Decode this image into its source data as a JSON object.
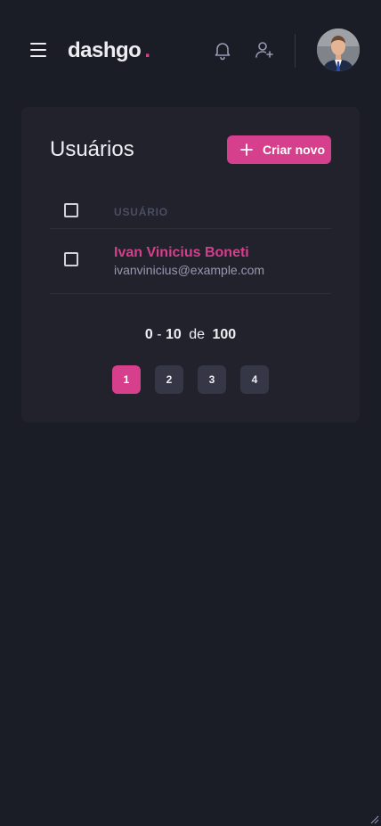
{
  "header": {
    "logo_text": "dashgo",
    "logo_dot": ".",
    "icons": [
      "menu-icon",
      "bell-icon",
      "user-plus-icon"
    ],
    "accent_color": "#d53f8c"
  },
  "card": {
    "title": "Usuários",
    "create_button_label": "Criar novo",
    "table": {
      "columns": [
        "USUÁRIO"
      ],
      "rows": [
        {
          "name": "Ivan Vinicius Boneti",
          "email": "ivanvinicius@example.com"
        }
      ]
    },
    "pagination": {
      "from": "0",
      "to": "10",
      "of_label": "de",
      "total": "100",
      "pages": [
        "1",
        "2",
        "3",
        "4"
      ],
      "current_page": "1"
    }
  }
}
